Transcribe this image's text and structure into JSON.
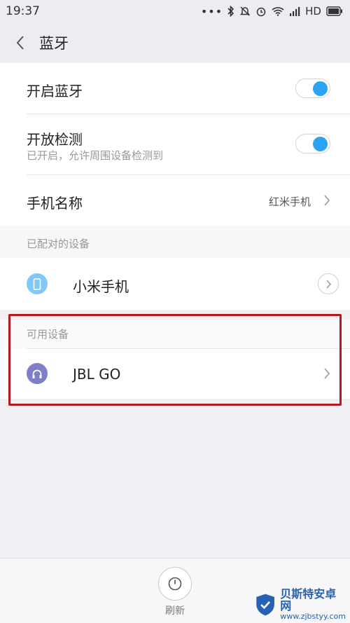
{
  "status_bar": {
    "time": "19:37",
    "network": "HD",
    "icons": [
      "more-dots-icon",
      "bluetooth-icon",
      "dnd-icon",
      "alarm-icon",
      "wifi-icon",
      "signal-icon",
      "battery-icon"
    ]
  },
  "header": {
    "title": "蓝牙",
    "back_icon": "chevron-left-icon"
  },
  "settings": {
    "bluetooth_on": {
      "label": "开启蓝牙",
      "enabled": true
    },
    "discoverable": {
      "label": "开放检测",
      "sub": "已开启，允许周围设备检测到",
      "enabled": true
    },
    "device_name": {
      "label": "手机名称",
      "value": "红米手机"
    }
  },
  "paired": {
    "section_title": "已配对的设备",
    "devices": [
      {
        "name": "小米手机",
        "icon": "phone-icon",
        "icon_color": "#83c8f4"
      }
    ]
  },
  "available": {
    "section_title": "可用设备",
    "devices": [
      {
        "name": "JBL GO",
        "icon": "headphones-icon",
        "icon_color": "#7e7fc6"
      }
    ]
  },
  "bottom": {
    "refresh_label": "刷新",
    "refresh_icon": "clock-icon"
  },
  "colors": {
    "accent": "#2aa3f3",
    "highlight": "#b11a22"
  },
  "watermark": {
    "title": "贝斯特安卓网",
    "url": "www.zjbstyy.com"
  }
}
